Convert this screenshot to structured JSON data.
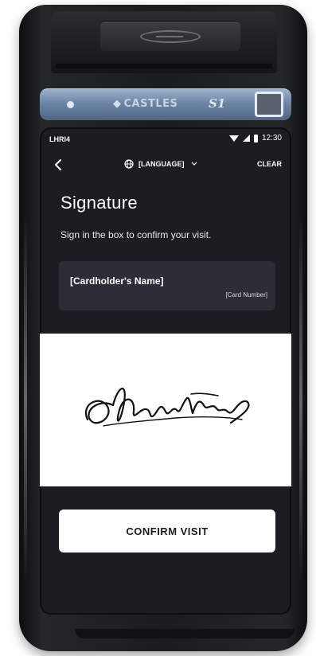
{
  "device": {
    "brand": "CASTLES",
    "model": "S1"
  },
  "status_bar": {
    "terminal_id": "LHRI4",
    "time": "12:30"
  },
  "header": {
    "back_icon": "chevron-left-icon",
    "language_icon": "globe-icon",
    "language_label": "[LANGUAGE]",
    "clear_label": "CLEAR"
  },
  "page": {
    "title": "Signature",
    "subtitle": "Sign in the box to confirm your visit."
  },
  "card": {
    "holder_name": "[Cardholder's Name]",
    "card_number": "[Card Number]"
  },
  "signature_area": {
    "background": "#ffffff",
    "ink": "#111111"
  },
  "actions": {
    "confirm_label": "CONFIRM VISIT"
  },
  "colors": {
    "screen_bg": "#1b1d22",
    "panel_bg": "#2b2e34",
    "text_primary": "#ffffff",
    "accent_strip": "#6e86a6"
  }
}
